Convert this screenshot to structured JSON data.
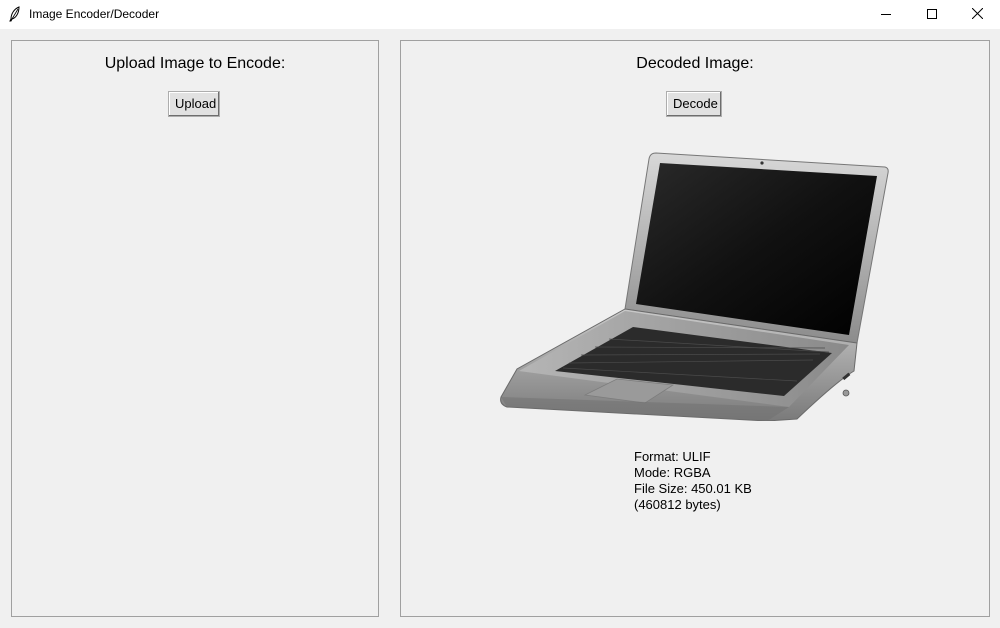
{
  "window": {
    "title": "Image Encoder/Decoder"
  },
  "left_panel": {
    "heading": "Upload Image to Encode:",
    "upload_label": "Upload"
  },
  "right_panel": {
    "heading": "Decoded Image:",
    "decode_label": "Decode",
    "image_subject": "laptop",
    "info": {
      "format": "Format: ULIF",
      "mode": "Mode: RGBA",
      "file_size": "File Size: 450.01 KB",
      "bytes": "(460812 bytes)"
    }
  },
  "icons": {
    "app": "feather-icon",
    "minimize": "minimize-icon",
    "maximize": "maximize-icon",
    "close": "close-icon"
  }
}
